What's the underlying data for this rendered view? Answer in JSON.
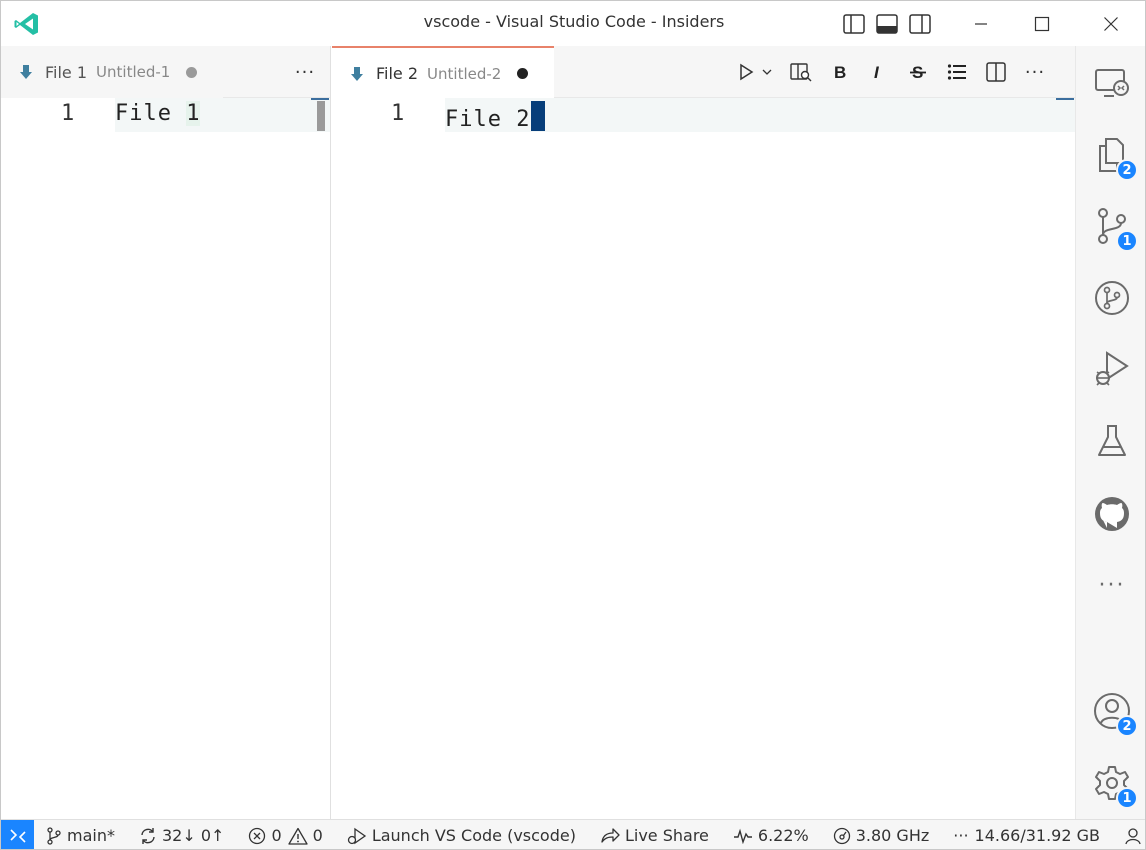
{
  "window": {
    "title": "vscode - Visual Studio Code - Insiders"
  },
  "left_group": {
    "tab": {
      "name": "File 1",
      "description": "Untitled-1"
    },
    "more_actions": "···",
    "line_number": "1",
    "line_text_main": "File ",
    "line_text_match": "1"
  },
  "right_group": {
    "tab": {
      "name": "File 2",
      "description": "Untitled-2"
    },
    "line_number": "1",
    "line_text_main": "File 2"
  },
  "activity_bar": {
    "items": [
      {
        "name": "remote-explorer",
        "badge": ""
      },
      {
        "name": "explorer",
        "badge": "2"
      },
      {
        "name": "source-control",
        "badge": "1"
      },
      {
        "name": "gitlens",
        "badge": ""
      },
      {
        "name": "run-and-debug",
        "badge": ""
      },
      {
        "name": "testing",
        "badge": ""
      },
      {
        "name": "github",
        "badge": ""
      },
      {
        "name": "more",
        "badge": ""
      }
    ],
    "accounts_badge": "2",
    "manage_badge": "1",
    "more_label": "···"
  },
  "status_bar": {
    "branch": "main*",
    "sync": "32↓ 0↑",
    "errors": "0",
    "warnings": "0",
    "launch": "Launch VS Code (vscode)",
    "live_share": "Live Share",
    "cpu": "6.22%",
    "freq": "3.80 GHz",
    "memory": "14.66/31.92 GB",
    "more": "···"
  },
  "colors": {
    "accent": "#1a85ff",
    "tab_border": "#e8826a",
    "cursor": "#073e7a",
    "file_icon": "#3f7f9f",
    "logo": "#24bfa5"
  }
}
